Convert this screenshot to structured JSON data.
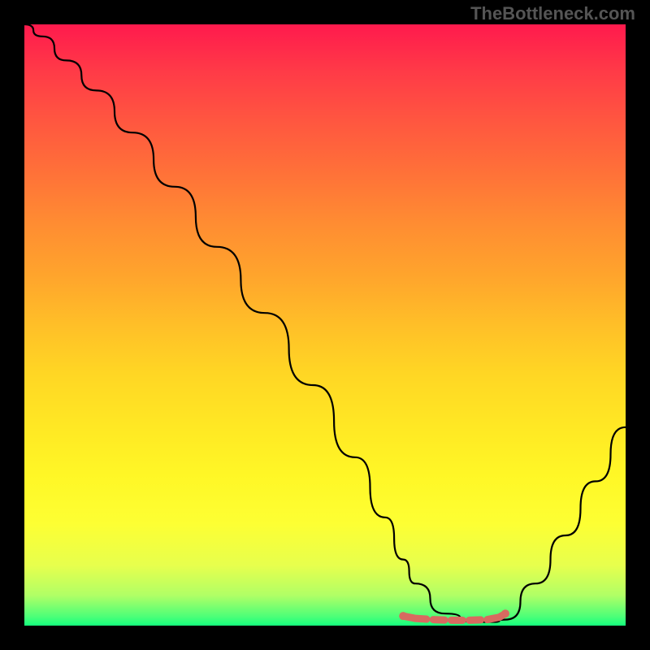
{
  "watermark": "TheBottleneck.com",
  "chart_data": {
    "type": "line",
    "title": "",
    "xlabel": "",
    "ylabel": "",
    "xlim": [
      0,
      100
    ],
    "ylim": [
      0,
      100
    ],
    "series": [
      {
        "name": "bottleneck-curve",
        "x": [
          0,
          3,
          7,
          12,
          18,
          25,
          32,
          40,
          48,
          55,
          60,
          63,
          65,
          70,
          75,
          78,
          80,
          85,
          90,
          95,
          100
        ],
        "values": [
          100,
          98,
          94,
          89,
          82,
          73,
          63,
          52,
          40,
          28,
          18,
          11,
          7,
          2,
          0.6,
          0.6,
          1,
          7,
          15,
          24,
          33
        ]
      },
      {
        "name": "optimal-range-marker",
        "x": [
          63,
          65,
          68,
          71,
          74,
          77,
          79,
          80
        ],
        "values": [
          1.6,
          1.2,
          1.0,
          0.9,
          0.9,
          1.0,
          1.4,
          2.0
        ]
      }
    ],
    "colors": {
      "curve": "#000000",
      "marker": "#d86a60"
    }
  }
}
